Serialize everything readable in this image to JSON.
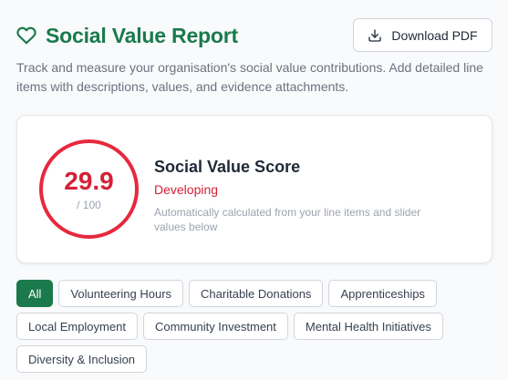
{
  "header": {
    "title": "Social Value Report",
    "download_label": "Download PDF"
  },
  "subtitle": "Track and measure your organisation's social value contributions. Add detailed line items with descriptions, values, and evidence attachments.",
  "score": {
    "value": "29.9",
    "max": "/ 100",
    "heading": "Social Value Score",
    "level": "Developing",
    "note": "Automatically calculated from your line items and slider values below"
  },
  "filters": {
    "row1": [
      "All",
      "Volunteering Hours",
      "Charitable Donations",
      "Apprenticeships"
    ],
    "row2": [
      "Local Employment",
      "Community Investment",
      "Mental Health Initiatives"
    ],
    "row3": [
      "Diversity & Inclusion"
    ],
    "active": "All"
  },
  "colors": {
    "brand_green": "#1a7a4c",
    "score_red": "#d61f35"
  },
  "icons": {
    "title_icon": "heart-icon",
    "download_icon": "download-icon"
  }
}
